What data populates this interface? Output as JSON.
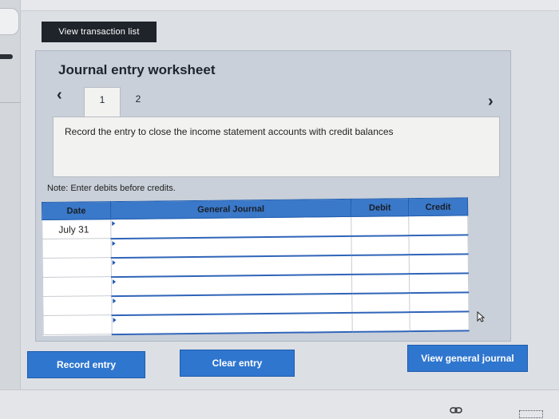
{
  "toolbar": {
    "view_transaction_list": "View transaction list"
  },
  "worksheet": {
    "title": "Journal entry worksheet",
    "tabs": [
      {
        "label": "1"
      },
      {
        "label": "2"
      }
    ],
    "instruction": "Record the entry to close the income statement accounts with credit balances",
    "note": "Note: Enter debits before credits."
  },
  "table": {
    "headers": {
      "date": "Date",
      "general_journal": "General Journal",
      "debit": "Debit",
      "credit": "Credit"
    },
    "rows": [
      {
        "date": "July 31",
        "account": "",
        "debit": "",
        "credit": ""
      },
      {
        "date": "",
        "account": "",
        "debit": "",
        "credit": ""
      },
      {
        "date": "",
        "account": "",
        "debit": "",
        "credit": ""
      },
      {
        "date": "",
        "account": "",
        "debit": "",
        "credit": ""
      },
      {
        "date": "",
        "account": "",
        "debit": "",
        "credit": ""
      },
      {
        "date": "",
        "account": "",
        "debit": "",
        "credit": ""
      }
    ]
  },
  "actions": {
    "record_entry": "Record entry",
    "clear_entry": "Clear entry",
    "view_general_journal": "View general journal"
  },
  "colors": {
    "accent": "#2f76cf",
    "header": "#3a78c9",
    "dark_button": "#1f242b"
  },
  "icons": [
    "chevron-left-icon",
    "chevron-right-icon",
    "pointer-cursor-icon",
    "link-icon",
    "grid-icon"
  ]
}
